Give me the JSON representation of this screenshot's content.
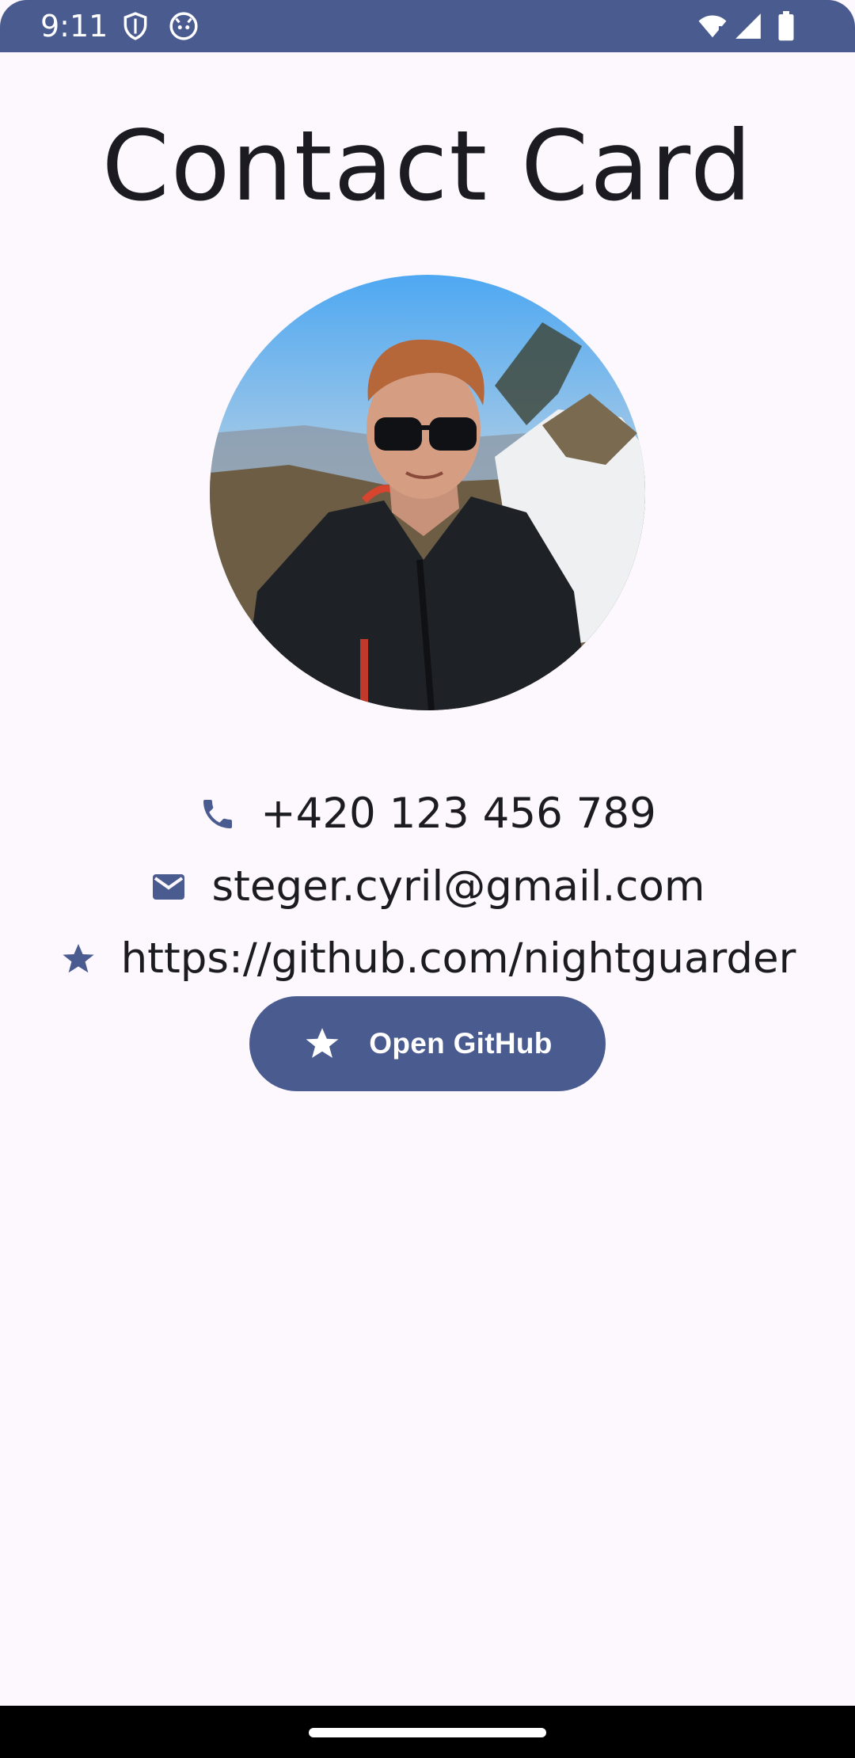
{
  "status_bar": {
    "time": "9:11",
    "left_icons": [
      "shield-icon",
      "android-face-icon"
    ],
    "right_icons": [
      "wifi-icon",
      "signal-icon",
      "battery-icon"
    ],
    "color": "#4a5b90"
  },
  "page": {
    "title": "Contact Card"
  },
  "profile": {
    "avatar": "profile-photo"
  },
  "contact": {
    "phone": "+420 123 456 789",
    "email": "steger.cyril@gmail.com",
    "website": "https://github.com/nightguarder"
  },
  "icons": {
    "phone": "phone-icon",
    "email": "mail-icon",
    "website": "star-icon"
  },
  "button": {
    "label": "Open GitHub",
    "icon": "star-icon"
  },
  "colors": {
    "primary": "#4a5b90",
    "background": "#fcf8fd",
    "text": "#1b1b21"
  }
}
